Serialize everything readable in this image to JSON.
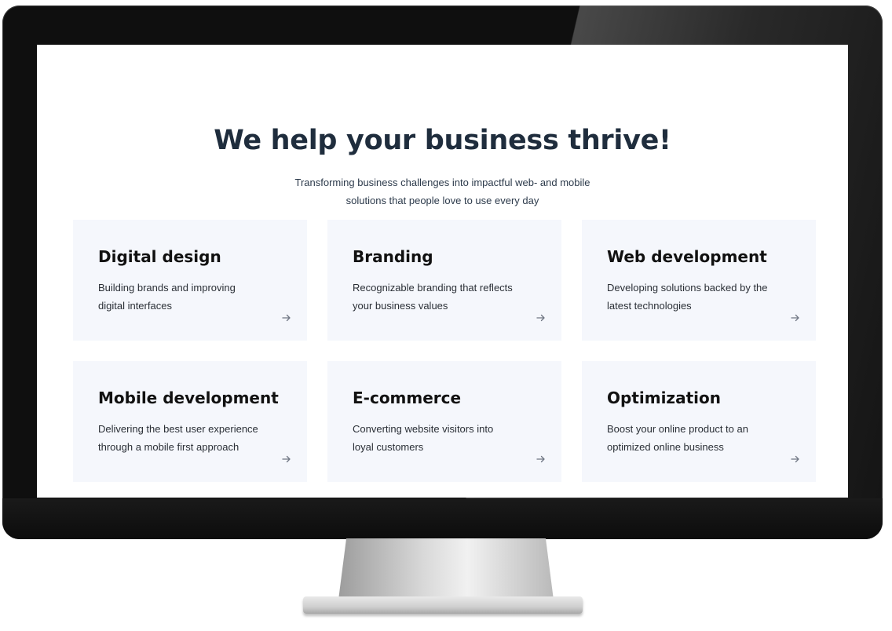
{
  "hero": {
    "title": "We help your business thrive!",
    "subtitle_line1": "Transforming business challenges into impactful web- and mobile",
    "subtitle_line2": "solutions that people love to use every day"
  },
  "services": [
    {
      "title": "Digital design",
      "desc_line1": "Building brands and improving",
      "desc_line2": "digital interfaces",
      "icon": "arrow-right-icon"
    },
    {
      "title": "Branding",
      "desc_line1": "Recognizable branding that reflects",
      "desc_line2": "your business values",
      "icon": "arrow-right-icon"
    },
    {
      "title": "Web development",
      "desc_line1": "Developing solutions backed by the",
      "desc_line2": "latest technologies",
      "icon": "arrow-right-icon"
    },
    {
      "title": "Mobile development",
      "desc_line1": "Delivering the best user experience",
      "desc_line2": "through a mobile first approach",
      "icon": "arrow-right-icon"
    },
    {
      "title": "E-commerce",
      "desc_line1": "Converting website visitors into",
      "desc_line2": "loyal customers",
      "icon": "arrow-right-icon"
    },
    {
      "title": "Optimization",
      "desc_line1": "Boost your online product to an",
      "desc_line2": "optimized online business",
      "icon": "arrow-right-icon"
    }
  ],
  "colors": {
    "heading": "#1f2d3d",
    "card_background": "#f5f7fc",
    "card_title": "#111111",
    "arrow": "#6f7683"
  }
}
